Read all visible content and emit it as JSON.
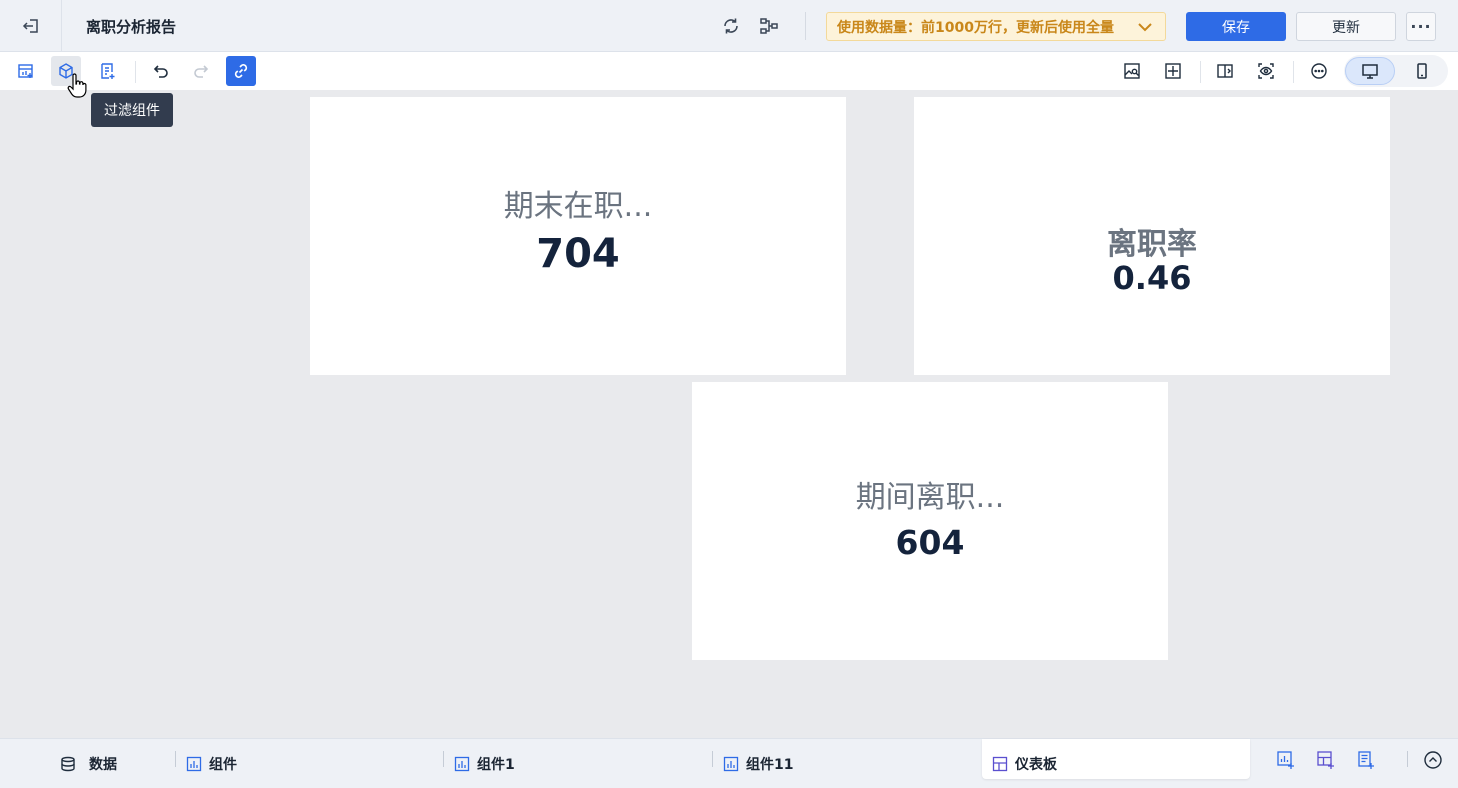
{
  "header": {
    "title": "离职分析报告",
    "usage_notice": "使用数据量：前1000万行，更新后使用全量",
    "save_label": "保存",
    "update_label": "更新",
    "more_label": "···"
  },
  "toolbar": {
    "tooltip": "过滤组件"
  },
  "cards": [
    {
      "label": "期末在职...",
      "value": "704"
    },
    {
      "label": "离职率",
      "value": "0.46"
    },
    {
      "label": "期间离职...",
      "value": "604"
    }
  ],
  "bottom_tabs": [
    {
      "label": "数据",
      "icon": "database-icon"
    },
    {
      "label": "组件",
      "icon": "chart-icon"
    },
    {
      "label": "组件1",
      "icon": "chart-icon"
    },
    {
      "label": "组件11",
      "icon": "chart-icon"
    },
    {
      "label": "仪表板",
      "icon": "dashboard-icon"
    }
  ],
  "colors": {
    "primary": "#2e6be6",
    "warning_text": "#c9871a",
    "warning_bg": "#fdf3da",
    "value_text": "#14233c"
  }
}
